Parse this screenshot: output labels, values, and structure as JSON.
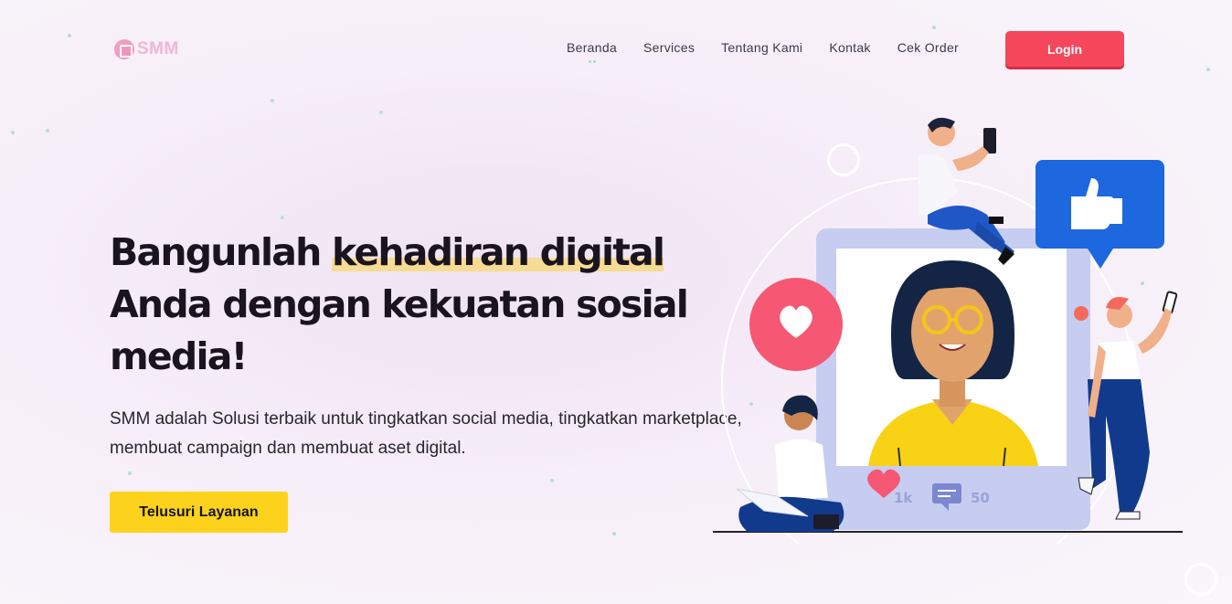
{
  "brand": {
    "name": "SMM",
    "logo_icon": "smm-logo-icon"
  },
  "nav": {
    "items": [
      {
        "label": "Beranda",
        "active": true
      },
      {
        "label": "Services",
        "active": false
      },
      {
        "label": "Tentang Kami",
        "active": false
      },
      {
        "label": "Kontak",
        "active": false
      },
      {
        "label": "Cek Order",
        "active": false
      }
    ],
    "login_label": "Login"
  },
  "hero": {
    "title_part1": "Bangunlah ",
    "title_highlight": "kehadiran digital",
    "title_part2": " Anda dengan kekuatan sosial media!",
    "description": "SMM adalah Solusi terbaik untuk tingkatkan social media, tingkatkan marketplace, membuat campaign dan membuat aset digital.",
    "cta_label": "Telusuri Layanan"
  },
  "illustration": {
    "likes_count": "1k",
    "comments_count": "50",
    "icons": [
      "heart-icon",
      "thumbs-up-icon",
      "comment-icon"
    ]
  },
  "colors": {
    "accent_red": "#f5465b",
    "cta_yellow": "#fcd21c",
    "highlight": "#f7dc93",
    "like_blue": "#1d67df",
    "heart_pink": "#f65773"
  }
}
